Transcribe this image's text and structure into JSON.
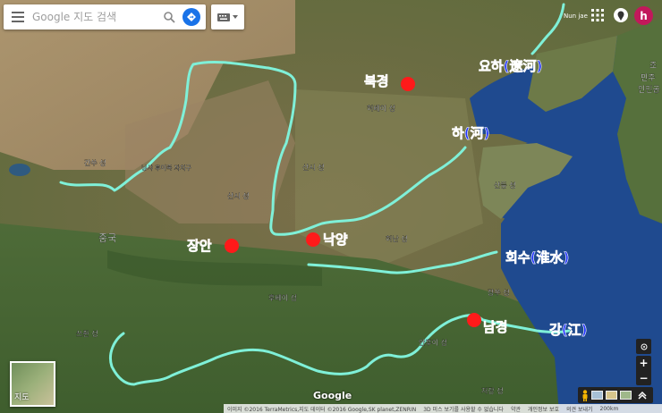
{
  "search": {
    "placeholder": "Google 지도 검색"
  },
  "top_right": {
    "avatar_letter": "h",
    "place_fragment": "Nun jae"
  },
  "cities": [
    {
      "name": "북경"
    },
    {
      "name": "장안"
    },
    {
      "name": "낙양"
    },
    {
      "name": "남경"
    }
  ],
  "rivers": [
    {
      "label": "요하(遼河)"
    },
    {
      "label": "하(河)"
    },
    {
      "label": "회수(淮水)"
    },
    {
      "label": "강(江)"
    }
  ],
  "base_labels": {
    "china": "중국",
    "hubei": "후베이 성",
    "shanxi": "산시 성",
    "shanxi2": "산시 성",
    "hebei": "허베이 성",
    "anhui": "안후이 성",
    "henan": "허난 성",
    "zhejiang": "저장 성",
    "sichuan": "쓰촨 성",
    "korea_north": "조",
    "korea_1": "민주",
    "korea_2": "인민공",
    "yangyang": "양양",
    "gansu": "간쑤 성",
    "ningxia": "닝샤 후이족 자치구",
    "shandong": "산둥 성",
    "jiangsu": "장쑤 성"
  },
  "minimap_label": "지도",
  "zoom": {
    "plus": "+",
    "minus": "−"
  },
  "logo": "Google",
  "attribution": {
    "data": "이미지 ©2016 TerraMetrics,지도 데이터 ©2016 Google,SK planet,ZENRIN",
    "notice": "3D 미스 보기를 사용할 수 없습니다",
    "terms": "약관",
    "privacy": "개인정보 보호",
    "feedback": "의견 보내기",
    "scale": "200km"
  },
  "colors": {
    "city_dot": "#ff1a1a",
    "city_label": "#ff2b2b",
    "river_line": "#7ff0d8",
    "river_label": "#1f33ff",
    "sea": "#1f4a8f"
  }
}
